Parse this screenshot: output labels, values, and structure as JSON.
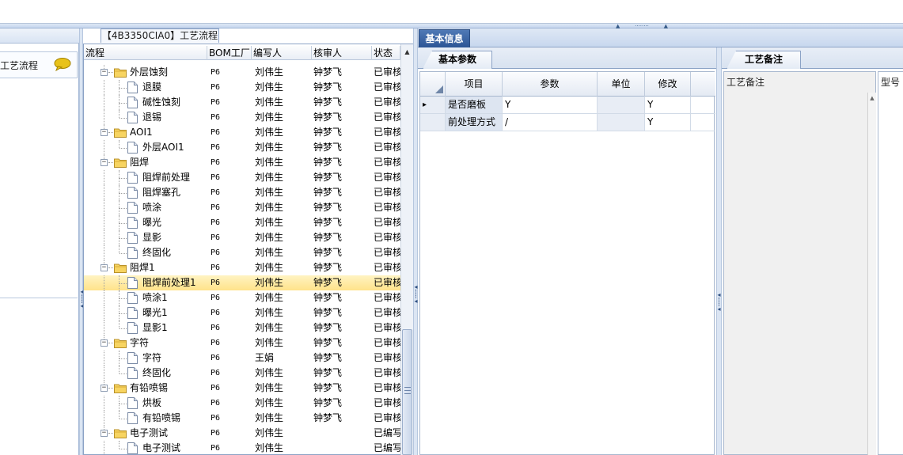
{
  "left": {
    "item_label": "工艺流程"
  },
  "tree_tab_label": "【4B3350CIA0】工艺流程",
  "tree": {
    "columns": [
      "流程",
      "BOM工厂",
      "编写人",
      "核审人",
      "状态"
    ],
    "rows": [
      {
        "level": 0,
        "type": "folder",
        "label": "外层蚀刻",
        "bom": "P6",
        "author": "刘伟生",
        "reviewer": "钟梦飞",
        "status": "已审核"
      },
      {
        "level": 1,
        "type": "doc",
        "label": "退膜",
        "bom": "P6",
        "author": "刘伟生",
        "reviewer": "钟梦飞",
        "status": "已审核"
      },
      {
        "level": 1,
        "type": "doc",
        "label": "碱性蚀刻",
        "bom": "P6",
        "author": "刘伟生",
        "reviewer": "钟梦飞",
        "status": "已审核"
      },
      {
        "level": 1,
        "type": "doc",
        "label": "退锡",
        "bom": "P6",
        "author": "刘伟生",
        "reviewer": "钟梦飞",
        "status": "已审核"
      },
      {
        "level": 0,
        "type": "folder",
        "label": "AOI1",
        "bom": "P6",
        "author": "刘伟生",
        "reviewer": "钟梦飞",
        "status": "已审核"
      },
      {
        "level": 1,
        "type": "doc",
        "label": "外层AOI1",
        "bom": "P6",
        "author": "刘伟生",
        "reviewer": "钟梦飞",
        "status": "已审核"
      },
      {
        "level": 0,
        "type": "folder",
        "label": "阻焊",
        "bom": "P6",
        "author": "刘伟生",
        "reviewer": "钟梦飞",
        "status": "已审核"
      },
      {
        "level": 1,
        "type": "doc",
        "label": "阻焊前处理",
        "bom": "P6",
        "author": "刘伟生",
        "reviewer": "钟梦飞",
        "status": "已审核"
      },
      {
        "level": 1,
        "type": "doc",
        "label": "阻焊塞孔",
        "bom": "P6",
        "author": "刘伟生",
        "reviewer": "钟梦飞",
        "status": "已审核"
      },
      {
        "level": 1,
        "type": "doc",
        "label": "喷涂",
        "bom": "P6",
        "author": "刘伟生",
        "reviewer": "钟梦飞",
        "status": "已审核"
      },
      {
        "level": 1,
        "type": "doc",
        "label": "曝光",
        "bom": "P6",
        "author": "刘伟生",
        "reviewer": "钟梦飞",
        "status": "已审核"
      },
      {
        "level": 1,
        "type": "doc",
        "label": "显影",
        "bom": "P6",
        "author": "刘伟生",
        "reviewer": "钟梦飞",
        "status": "已审核"
      },
      {
        "level": 1,
        "type": "doc",
        "label": "终固化",
        "bom": "P6",
        "author": "刘伟生",
        "reviewer": "钟梦飞",
        "status": "已审核"
      },
      {
        "level": 0,
        "type": "folder",
        "label": "阻焊1",
        "bom": "P6",
        "author": "刘伟生",
        "reviewer": "钟梦飞",
        "status": "已审核"
      },
      {
        "level": 1,
        "type": "doc",
        "label": "阻焊前处理1",
        "bom": "P6",
        "author": "刘伟生",
        "reviewer": "钟梦飞",
        "status": "已审核",
        "selected": true
      },
      {
        "level": 1,
        "type": "doc",
        "label": "喷涂1",
        "bom": "P6",
        "author": "刘伟生",
        "reviewer": "钟梦飞",
        "status": "已审核"
      },
      {
        "level": 1,
        "type": "doc",
        "label": "曝光1",
        "bom": "P6",
        "author": "刘伟生",
        "reviewer": "钟梦飞",
        "status": "已审核"
      },
      {
        "level": 1,
        "type": "doc",
        "label": "显影1",
        "bom": "P6",
        "author": "刘伟生",
        "reviewer": "钟梦飞",
        "status": "已审核"
      },
      {
        "level": 0,
        "type": "folder",
        "label": "字符",
        "bom": "P6",
        "author": "刘伟生",
        "reviewer": "钟梦飞",
        "status": "已审核"
      },
      {
        "level": 1,
        "type": "doc",
        "label": "字符",
        "bom": "P6",
        "author": "王娟",
        "reviewer": "钟梦飞",
        "status": "已审核"
      },
      {
        "level": 1,
        "type": "doc",
        "label": "终固化",
        "bom": "P6",
        "author": "刘伟生",
        "reviewer": "钟梦飞",
        "status": "已审核"
      },
      {
        "level": 0,
        "type": "folder",
        "label": "有铅喷锡",
        "bom": "P6",
        "author": "刘伟生",
        "reviewer": "钟梦飞",
        "status": "已审核"
      },
      {
        "level": 1,
        "type": "doc",
        "label": "烘板",
        "bom": "P6",
        "author": "刘伟生",
        "reviewer": "钟梦飞",
        "status": "已审核"
      },
      {
        "level": 1,
        "type": "doc",
        "label": "有铅喷锡",
        "bom": "P6",
        "author": "刘伟生",
        "reviewer": "钟梦飞",
        "status": "已审核"
      },
      {
        "level": 0,
        "type": "folder",
        "label": "电子测试",
        "bom": "P6",
        "author": "刘伟生",
        "reviewer": "",
        "status": "已编写"
      },
      {
        "level": 1,
        "type": "doc",
        "label": "电子测试",
        "bom": "P6",
        "author": "刘伟生",
        "reviewer": "",
        "status": "已编写"
      }
    ]
  },
  "info_tab_label": "基本信息",
  "params": {
    "tab_label": "基本参数",
    "columns": [
      "项目",
      "参数",
      "单位",
      "修改"
    ],
    "rows": [
      {
        "item": "是否磨板",
        "param": "Y",
        "unit": "",
        "modify": "Y",
        "current": true
      },
      {
        "item": "前处理方式",
        "param": "/",
        "unit": "",
        "modify": "Y",
        "current": false
      }
    ]
  },
  "notes": {
    "tab_label": "工艺备注",
    "field_label": "工艺备注",
    "model_label": "型号"
  },
  "colors": {
    "accent": "#2c5595",
    "selection": "#ffe38a",
    "folder": "#f2c744"
  }
}
